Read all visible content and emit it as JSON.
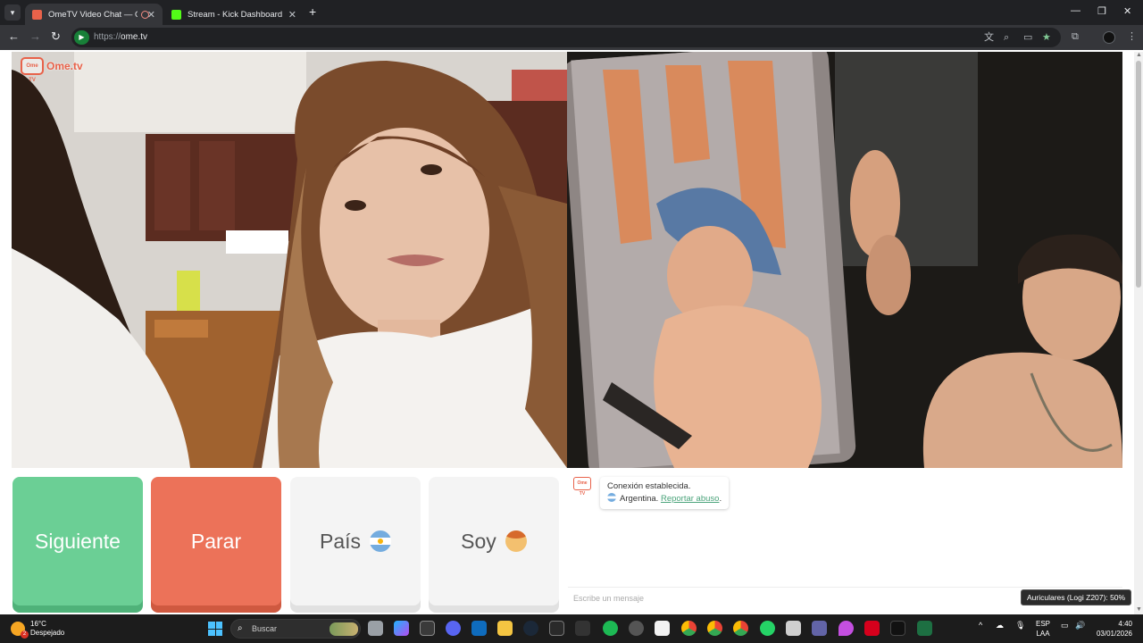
{
  "browser": {
    "tabs": [
      {
        "title": "OmeTV Video Chat — OmeTV",
        "active": true,
        "favicon_color": "#e8624a"
      },
      {
        "title": "Stream - Kick Dashboard",
        "active": false,
        "favicon_color": "#53fc18"
      }
    ],
    "new_tab": "+",
    "window_controls": {
      "minimize": "—",
      "maximize": "❐",
      "close": "✕"
    },
    "url": {
      "scheme": "https://",
      "host": "ome.tv"
    }
  },
  "page": {
    "logo_icon_text": "Ome TV",
    "logo_text": "Ome.tv",
    "buttons": {
      "next": "Siguiente",
      "stop": "Parar",
      "country": "País",
      "gender": "Soy"
    },
    "chat": {
      "cam_icon_text": "Ome TV",
      "status": "Conexión establecida.",
      "country": "Argentina.",
      "report_link": "Reportar abuso",
      "report_suffix": ".",
      "message_placeholder": "Escribe un mensaje"
    }
  },
  "system": {
    "tooltip": "Auriculares (Logi Z207): 50%",
    "weather": {
      "temp": "16°C",
      "condition": "Despejado",
      "badge": "2"
    },
    "search_label": "Buscar",
    "language": {
      "line1": "ESP",
      "line2": "LAA"
    },
    "clock": {
      "time": "4:40",
      "date": "03/01/2026"
    }
  },
  "colors": {
    "accent": "#e8624a",
    "next_button": "#6bcf95",
    "stop_button": "#ec7259",
    "link": "#4aa37a"
  }
}
